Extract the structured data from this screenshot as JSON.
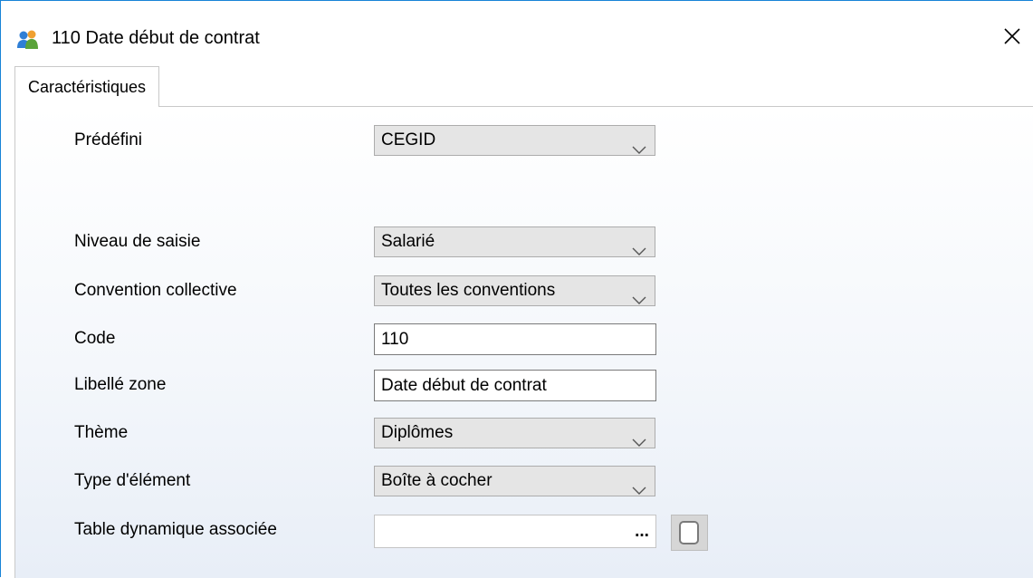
{
  "window": {
    "title": "110 Date début de contrat",
    "close_glyph": "✕"
  },
  "tabs": [
    {
      "label": "Caractéristiques",
      "active": true
    }
  ],
  "form": {
    "predefini": {
      "label": "Prédéfini",
      "value": "CEGID"
    },
    "niveau_saisie": {
      "label": "Niveau de saisie",
      "value": "Salarié"
    },
    "convention": {
      "label": "Convention collective",
      "value": "Toutes les conventions"
    },
    "code": {
      "label": "Code",
      "value": "110"
    },
    "libelle": {
      "label": "Libellé zone",
      "value": "Date début de contrat"
    },
    "theme": {
      "label": "Thème",
      "value": "Diplômes"
    },
    "type_element": {
      "label": "Type d'élément",
      "value": "Boîte à cocher"
    },
    "table_dynamique": {
      "label": "Table dynamique associée",
      "value": "",
      "browse_label": "..."
    }
  },
  "icons": {
    "app": "users-icon",
    "dropdown": "chevron-down-icon",
    "close": "close-icon"
  },
  "colors": {
    "window_border": "#1883d7",
    "combo_bg": "#e5e5e5"
  }
}
